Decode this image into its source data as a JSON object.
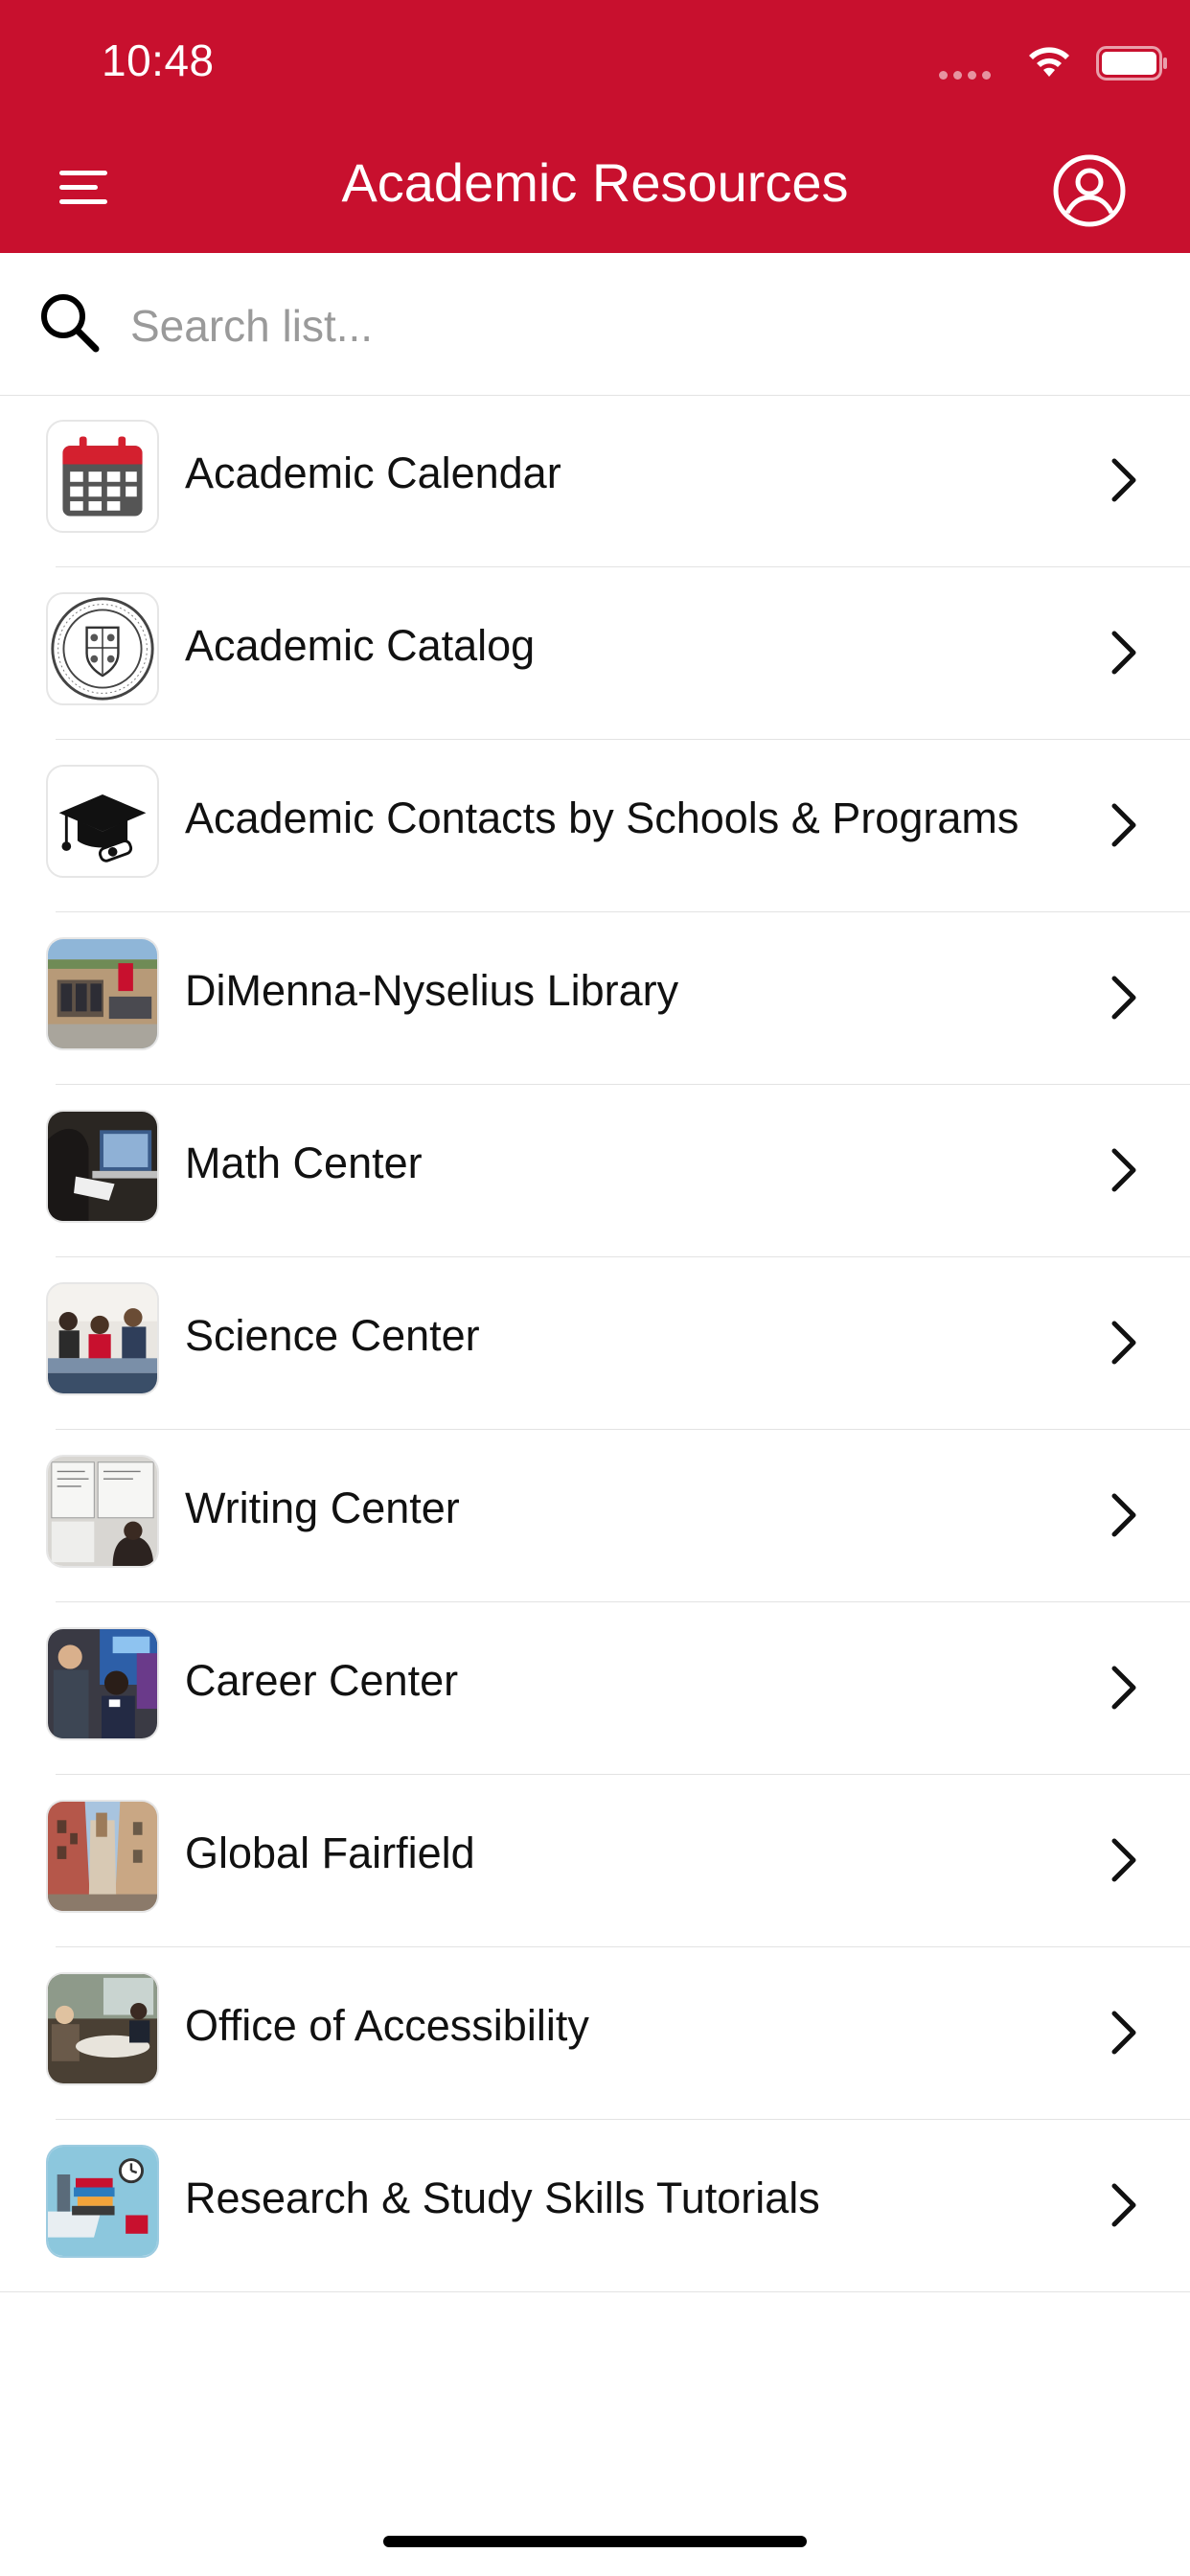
{
  "status_bar": {
    "time": "10:48"
  },
  "header": {
    "title": "Academic Resources",
    "menu_icon": "hamburger-menu-icon",
    "profile_icon": "user-circle-icon",
    "background_color": "#c8102e"
  },
  "search": {
    "placeholder": "Search list...",
    "value": "",
    "icon": "search-icon"
  },
  "items": [
    {
      "label": "Academic Calendar",
      "icon": "calendar-icon"
    },
    {
      "label": "Academic Catalog",
      "icon": "university-seal-icon"
    },
    {
      "label": "Academic Contacts by Schools & Programs",
      "icon": "graduation-cap-icon"
    },
    {
      "label": "DiMenna-Nyselius Library",
      "icon": "library-photo"
    },
    {
      "label": "Math Center",
      "icon": "math-center-photo"
    },
    {
      "label": "Science Center",
      "icon": "science-center-photo"
    },
    {
      "label": "Writing Center",
      "icon": "writing-center-photo"
    },
    {
      "label": "Career Center",
      "icon": "career-center-photo"
    },
    {
      "label": "Global Fairfield",
      "icon": "global-fairfield-photo"
    },
    {
      "label": "Office of Accessibility",
      "icon": "accessibility-office-photo"
    },
    {
      "label": "Research & Study Skills Tutorials",
      "icon": "research-tutorials-illustration"
    }
  ]
}
